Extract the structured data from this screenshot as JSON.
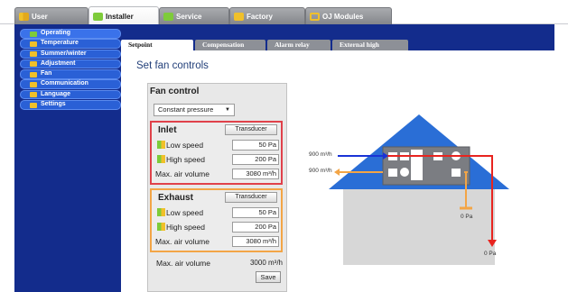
{
  "top_tabs": [
    {
      "label": "User",
      "icon": "users-icon",
      "color": "#f0c02a",
      "active": false
    },
    {
      "label": "Installer",
      "icon": "installer-icon",
      "color": "#7ecb3a",
      "active": true
    },
    {
      "label": "Service",
      "icon": "service-icon",
      "color": "#7ecb3a",
      "active": false
    },
    {
      "label": "Factory",
      "icon": "factory-icon",
      "color": "#f0c02a",
      "active": false
    },
    {
      "label": "OJ Modules",
      "icon": "modules-icon",
      "color": "#f0c02a",
      "active": false
    }
  ],
  "sidebar": {
    "items": [
      {
        "label": "Operating",
        "icon": "operating-icon",
        "color": "#7ecb3a"
      },
      {
        "label": "Temperature",
        "icon": "temperature-icon",
        "color": "#f0c02a"
      },
      {
        "label": "Summer/winter",
        "icon": "summer-winter-icon",
        "color": "#f0c02a"
      },
      {
        "label": "Adjustment",
        "icon": "adjustment-icon",
        "color": "#f0c02a"
      },
      {
        "label": "Fan",
        "icon": "fan-icon",
        "color": "#f0c02a"
      },
      {
        "label": "Communication",
        "icon": "communication-icon",
        "color": "#f0c02a"
      },
      {
        "label": "Language",
        "icon": "language-icon",
        "color": "#f0c02a"
      },
      {
        "label": "Settings",
        "icon": "settings-icon",
        "color": "#f0c02a"
      }
    ]
  },
  "sub_tabs": [
    "Setpoint",
    "Compensation",
    "Alarm relay",
    "External high"
  ],
  "page_title": "Set fan controls",
  "fan_control": {
    "heading": "Fan control",
    "mode": "Constant pressure",
    "inlet": {
      "title": "Inlet",
      "button": "Transducer",
      "low_label": "Low speed",
      "low_value": "50",
      "low_unit": "Pa",
      "high_label": "High speed",
      "high_value": "200",
      "high_unit": "Pa",
      "max_label": "Max. air volume",
      "max_value": "3080",
      "max_unit": "m³/h"
    },
    "exhaust": {
      "title": "Exhaust",
      "button": "Transducer",
      "low_label": "Low speed",
      "low_value": "50",
      "low_unit": "Pa",
      "high_label": "High speed",
      "high_value": "200",
      "high_unit": "Pa",
      "max_label": "Max. air volume",
      "max_value": "3080",
      "max_unit": "m³/h"
    },
    "max_air_label": "Max. air volume",
    "max_air_value": "3000 m³/h",
    "save_label": "Save"
  },
  "diagram": {
    "supply_flow": "900 m³/h",
    "extract_flow": "900 m³/h",
    "pressure_orange": "0 Pa",
    "pressure_red": "0 Pa",
    "colors": {
      "supply": "#1a33d6",
      "exhaust": "#e8241f",
      "extract": "#f3a546",
      "roof": "#2a6ed6",
      "unit": "#7b7d82"
    }
  }
}
